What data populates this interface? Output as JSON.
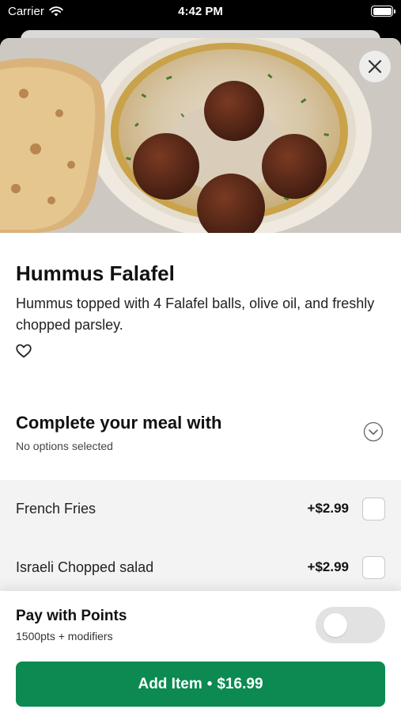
{
  "status_bar": {
    "carrier": "Carrier",
    "time": "4:42 PM"
  },
  "item": {
    "title": "Hummus Falafel",
    "description": "Hummus topped with 4 Falafel balls, olive oil, and freshly chopped parsley.",
    "image_icon": "hummus-falafel-photo"
  },
  "complete_meal": {
    "title": "Complete your meal with",
    "subtitle": "No options selected",
    "options": [
      {
        "name": "French Fries",
        "price": "+$2.99",
        "checked": false
      },
      {
        "name": "Israeli Chopped salad",
        "price": "+$2.99",
        "checked": false
      }
    ]
  },
  "points": {
    "title": "Pay with Points",
    "subtitle": "1500pts + modifiers",
    "enabled": false
  },
  "add_button": {
    "label": "Add Item",
    "separator": "•",
    "price": "$16.99"
  },
  "colors": {
    "accent": "#0c8a52",
    "options_bg": "#f3f3f3",
    "toggle_off": "#e2e2e2"
  }
}
